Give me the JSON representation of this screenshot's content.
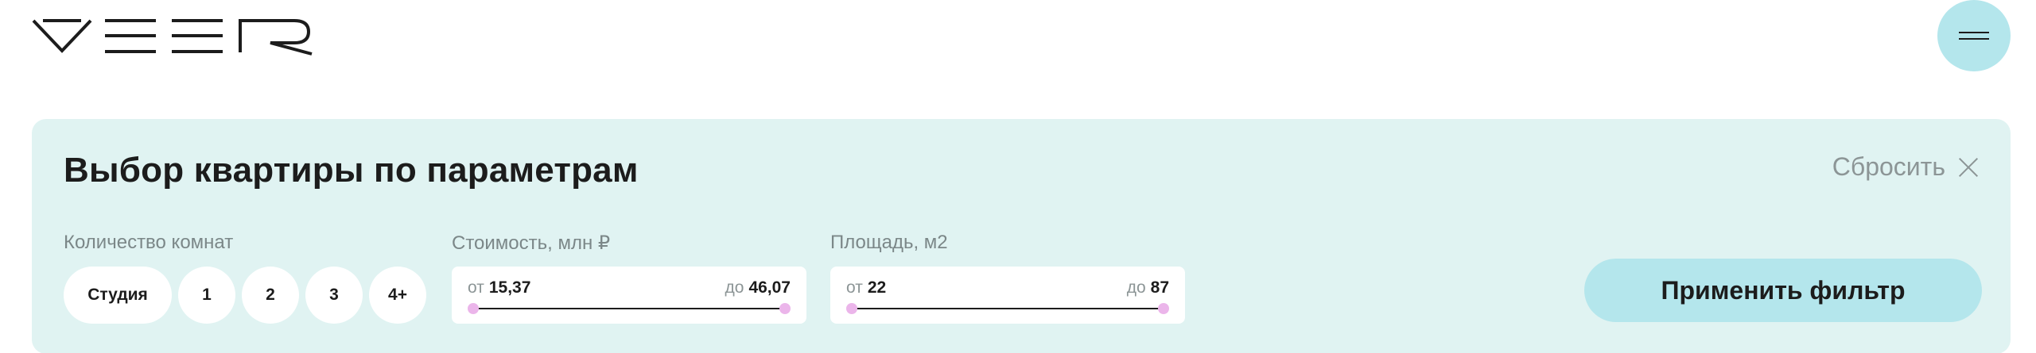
{
  "header": {
    "brand": "VEER",
    "menu_icon": "hamburger-icon"
  },
  "filter": {
    "title": "Выбор квартиры по параметрам",
    "reset_label": "Сбросить",
    "reset_icon": "close-icon",
    "rooms": {
      "label": "Количество комнат",
      "options": [
        "Студия",
        "1",
        "2",
        "3",
        "4+"
      ]
    },
    "price": {
      "label": "Стоимость, млн ₽",
      "from_prefix": "от",
      "from_value": "15,37",
      "to_prefix": "до",
      "to_value": "46,07"
    },
    "area": {
      "label": "Площадь, м2",
      "from_prefix": "от",
      "from_value": "22",
      "to_prefix": "до",
      "to_value": "87"
    },
    "apply_label": "Применить фильтр"
  },
  "colors": {
    "panel_bg": "#e0f3f2",
    "accent": "#b4e6ec",
    "thumb": "#ebb5ea",
    "muted_text": "#8c9596"
  }
}
